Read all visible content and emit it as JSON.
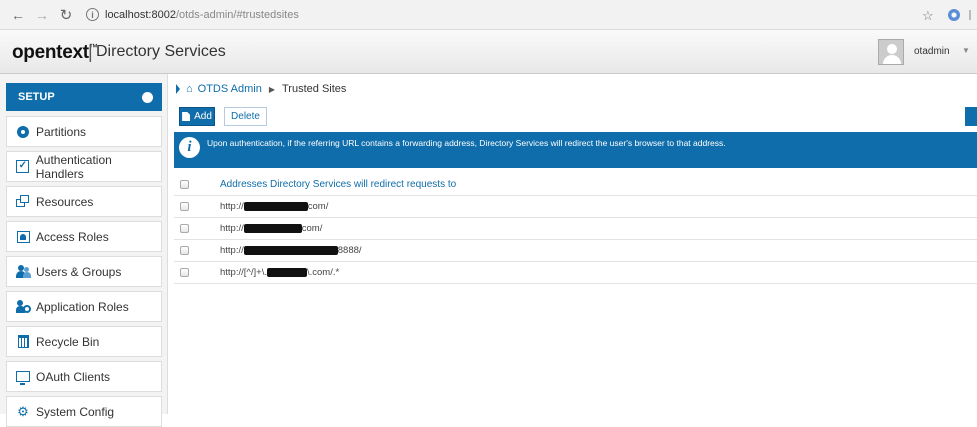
{
  "browser": {
    "url_host": "localhost:8002",
    "url_path": "/otds-admin/#trustedsites"
  },
  "header": {
    "brand": "opentext",
    "brand_sup": "™",
    "separator": "|",
    "product": "Directory Services",
    "user": "otadmin"
  },
  "sidebar": {
    "section": "SETUP",
    "items": [
      {
        "label": "Partitions",
        "icon": "partitions-icon"
      },
      {
        "label": "Authentication Handlers",
        "icon": "checkbox-icon"
      },
      {
        "label": "Resources",
        "icon": "resources-icon"
      },
      {
        "label": "Access Roles",
        "icon": "access-roles-icon"
      },
      {
        "label": "Users & Groups",
        "icon": "users-groups-icon"
      },
      {
        "label": "Application Roles",
        "icon": "application-roles-icon"
      },
      {
        "label": "Recycle Bin",
        "icon": "recycle-bin-icon"
      },
      {
        "label": "OAuth Clients",
        "icon": "oauth-clients-icon"
      },
      {
        "label": "System Config",
        "icon": "system-config-icon"
      }
    ]
  },
  "breadcrumb": {
    "root": "OTDS Admin",
    "current": "Trusted Sites"
  },
  "toolbar": {
    "add": "Add",
    "delete": "Delete"
  },
  "info": {
    "message": "Upon authentication, if the referring URL contains a forwarding address, Directory Services will redirect the user's browser to that address."
  },
  "table": {
    "header": "Addresses Directory Services will redirect requests to",
    "rows": [
      {
        "prefix": "http://",
        "suffix": "com/"
      },
      {
        "prefix": "http://",
        "suffix": "com/"
      },
      {
        "prefix": "http://",
        "suffix": "8888/"
      },
      {
        "prefix": "http://[^/]+\\.",
        "suffix": "\\.com/.*"
      }
    ]
  },
  "colors": {
    "accent": "#0f6dab"
  }
}
